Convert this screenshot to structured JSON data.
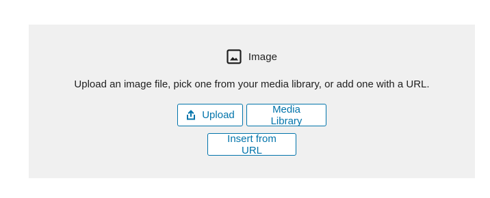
{
  "block": {
    "title": "Image",
    "icon": "image-icon",
    "instructions": "Upload an image file, pick one from your media library, or add one with a URL."
  },
  "buttons": {
    "upload_label": "Upload",
    "upload_icon": "upload-icon",
    "media_library_label": "Media Library",
    "insert_url_label": "Insert from URL"
  },
  "colors": {
    "accent": "#0073aa",
    "placeholder_bg": "#f0f0f0",
    "text": "#1e1e1e"
  }
}
